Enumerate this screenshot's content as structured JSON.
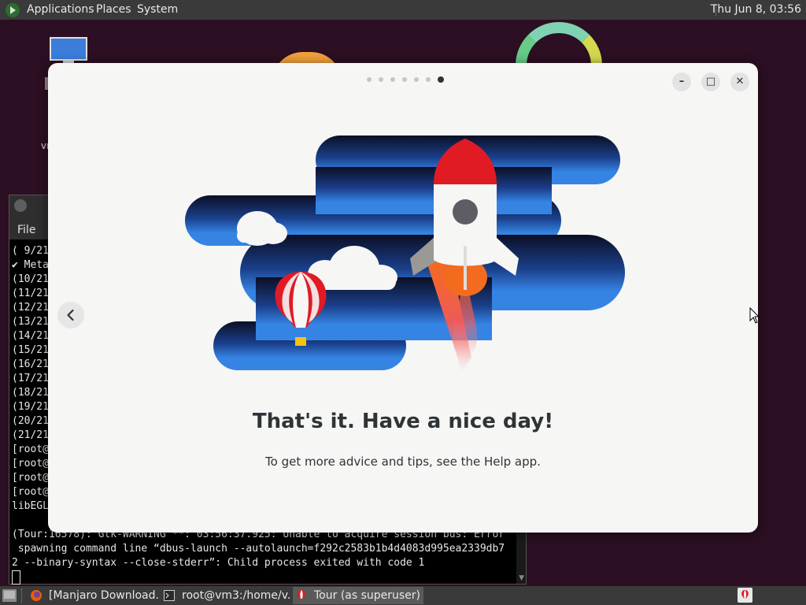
{
  "top_panel": {
    "menu": [
      "Applications",
      "Places",
      "System"
    ],
    "clock": "Thu Jun  8, 03:56"
  },
  "desktop": {
    "icon_label": "vm"
  },
  "terminal": {
    "menu_file": "File",
    "lines": [
      "( 9/21",
      "✔ Meta",
      "(10/21",
      "(11/21",
      "(12/21",
      "(13/21",
      "(14/21",
      "(15/21",
      "(16/21",
      "(17/21",
      "(18/21",
      "(19/21",
      "(20/21",
      "(21/21",
      "[root@",
      "[root@",
      "[root@",
      "[root@",
      "libEGL"
    ],
    "bottom_lines": [
      "(Tour:16578): Gtk-WARNING **: 03:56:37.925: Unable to acquire session bus: Error",
      " spawning command line “dbus-launch --autolaunch=f292c2583b1b4d4083d995ea2339db7",
      "2 --binary-syntax --close-stderr”: Child process exited with code 1"
    ]
  },
  "tour": {
    "page_count": 7,
    "current_page": 7,
    "title": "That's it. Have a nice day!",
    "subtitle": "To get more advice and tips, see the Help app.",
    "minimize_glyph": "–",
    "maximize_glyph": "□",
    "close_glyph": "✕"
  },
  "taskbar": {
    "tasks": [
      {
        "label": "[Manjaro Download...",
        "icon": "firefox-icon"
      },
      {
        "label": "root@vm3:/home/v...",
        "icon": "terminal-icon"
      },
      {
        "label": "Tour (as superuser)",
        "icon": "tour-icon",
        "active": true
      }
    ]
  },
  "colors": {
    "panel": "#3a3a3a",
    "dialog_bg": "#f6f6f5",
    "sky_dark": "#0a1026",
    "sky_blue": "#3584e4",
    "rocket_red": "#e01b24"
  }
}
